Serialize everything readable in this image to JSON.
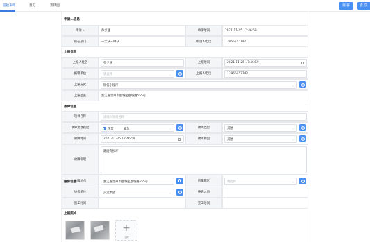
{
  "tabs": [
    "巡检表单",
    "意见",
    "流转图"
  ],
  "actions": {
    "save": "保 存",
    "submit": "提 交"
  },
  "sections": {
    "applicant": "申请人信息",
    "reporter": "上报信息",
    "fault": "故障信息",
    "repair": "维修信息",
    "photos": "上报照片"
  },
  "applicant": {
    "name_label": "申请人",
    "name": "乔夕迷",
    "time_label": "申请时间",
    "time": "2021-11-25 17:46:59",
    "dept_label": "所在部门",
    "dept": "一大队三中队",
    "phone_label": "申请人电话",
    "phone": "13966677742"
  },
  "reporter": {
    "name_label": "上报人姓名",
    "name": "乔夕迷",
    "time_label": "上报时间",
    "time": "2021-11-25 17:46:59",
    "unit_label": "报警单位",
    "unit_placeholder": "请选择",
    "phone_label": "上报人电话",
    "phone": "13966677742",
    "method_label": "上报方式",
    "method": "微信小程序",
    "location_label": "上报位置",
    "location": "浙江省温州市鹿城区鹿城路555号"
  },
  "fault": {
    "project_label": "项目名称",
    "project_placeholder": "请输入项目名称",
    "urgency_label": "故障紧急程度",
    "urgency_normal": "正常",
    "urgency_urgent": "紧急",
    "type_label": "故障类型",
    "type": "其他",
    "time_label": "故障时间",
    "time": "2021-11-25 17:46:59",
    "reason_label": "故障原因",
    "reason": "其他",
    "desc_label": "故障说明",
    "desc": "路面有损坏",
    "place_label": "故障地点",
    "place": "浙江省温州市鹿城区鹿城路555号",
    "district_label": "所属辖区",
    "district_placeholder": "请选择"
  },
  "repair": {
    "unit_label": "维修单位",
    "unit": "交运集团",
    "person_label": "维修人员",
    "start_label": "施工时间",
    "end_label": "完工时间"
  },
  "upload": {
    "label": "上传"
  }
}
